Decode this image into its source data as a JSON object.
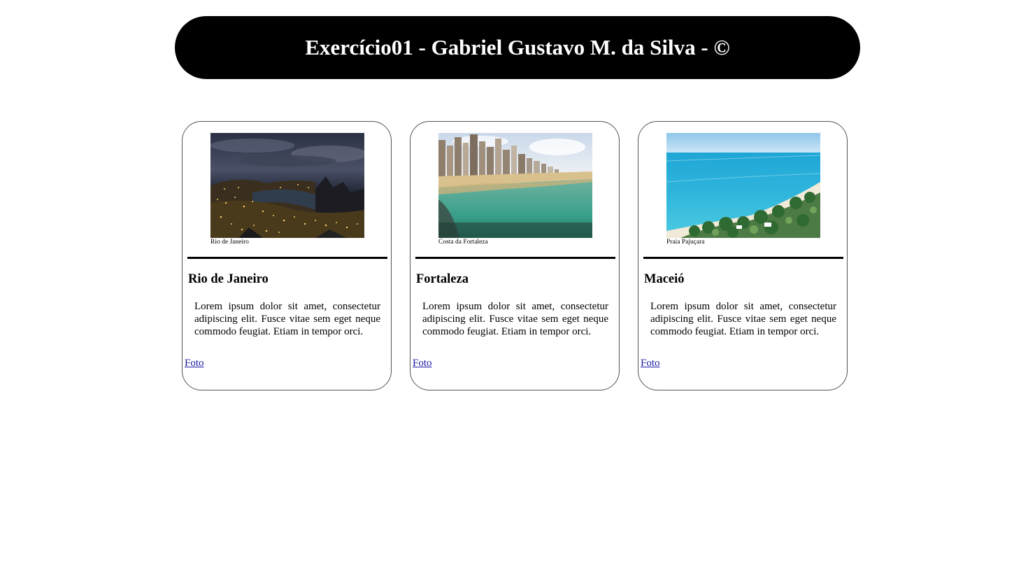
{
  "header": {
    "title": "Exercício01 - Gabriel Gustavo M. da Silva - ©"
  },
  "cards": [
    {
      "image_icon": "rio-de-janeiro-night-photo",
      "caption": "Rio de Janeiro",
      "city": "Rio de Janeiro",
      "description": "Lorem ipsum dolor sit amet, consectetur adipiscing elit. Fusce vitae sem eget neque commodo feugiat. Etiam in tempor orci.",
      "link_label": "Foto"
    },
    {
      "image_icon": "fortaleza-beach-skyline-photo",
      "caption": "Costa da Fortaleza",
      "city": "Fortaleza",
      "description": "Lorem ipsum dolor sit amet, consectetur adipiscing elit. Fusce vitae sem eget neque commodo feugiat. Etiam in tempor orci.",
      "link_label": "Foto"
    },
    {
      "image_icon": "praia-pajucara-beach-photo",
      "caption": "Praia Pajuçara",
      "city": "Maceió",
      "description": "Lorem ipsum dolor sit amet, consectetur adipiscing elit. Fusce vitae sem eget neque commodo feugiat. Etiam in tempor orci.",
      "link_label": "Foto"
    }
  ],
  "colors": {
    "header_bg": "#000000",
    "header_text": "#ffffff",
    "link": "#1a1aa6",
    "card_border": "#555555"
  }
}
